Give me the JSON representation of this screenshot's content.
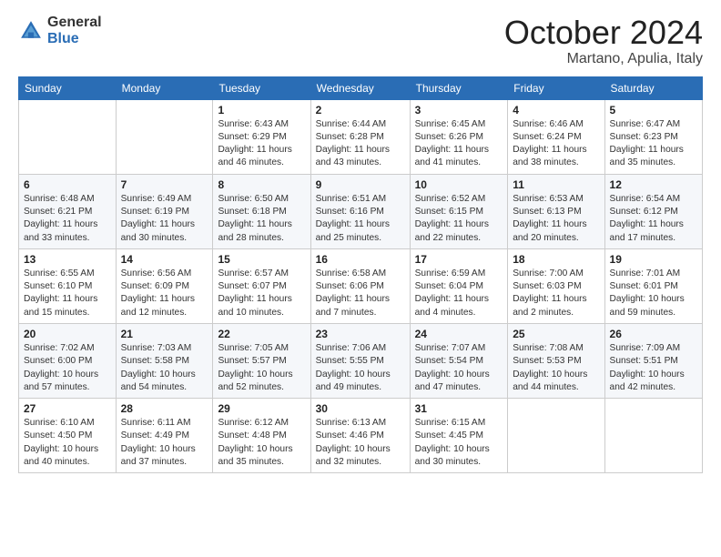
{
  "header": {
    "logo_general": "General",
    "logo_blue": "Blue",
    "title": "October 2024",
    "location": "Martano, Apulia, Italy"
  },
  "weekdays": [
    "Sunday",
    "Monday",
    "Tuesday",
    "Wednesday",
    "Thursday",
    "Friday",
    "Saturday"
  ],
  "weeks": [
    [
      {
        "day": "",
        "info": ""
      },
      {
        "day": "",
        "info": ""
      },
      {
        "day": "1",
        "info": "Sunrise: 6:43 AM\nSunset: 6:29 PM\nDaylight: 11 hours and 46 minutes."
      },
      {
        "day": "2",
        "info": "Sunrise: 6:44 AM\nSunset: 6:28 PM\nDaylight: 11 hours and 43 minutes."
      },
      {
        "day": "3",
        "info": "Sunrise: 6:45 AM\nSunset: 6:26 PM\nDaylight: 11 hours and 41 minutes."
      },
      {
        "day": "4",
        "info": "Sunrise: 6:46 AM\nSunset: 6:24 PM\nDaylight: 11 hours and 38 minutes."
      },
      {
        "day": "5",
        "info": "Sunrise: 6:47 AM\nSunset: 6:23 PM\nDaylight: 11 hours and 35 minutes."
      }
    ],
    [
      {
        "day": "6",
        "info": "Sunrise: 6:48 AM\nSunset: 6:21 PM\nDaylight: 11 hours and 33 minutes."
      },
      {
        "day": "7",
        "info": "Sunrise: 6:49 AM\nSunset: 6:19 PM\nDaylight: 11 hours and 30 minutes."
      },
      {
        "day": "8",
        "info": "Sunrise: 6:50 AM\nSunset: 6:18 PM\nDaylight: 11 hours and 28 minutes."
      },
      {
        "day": "9",
        "info": "Sunrise: 6:51 AM\nSunset: 6:16 PM\nDaylight: 11 hours and 25 minutes."
      },
      {
        "day": "10",
        "info": "Sunrise: 6:52 AM\nSunset: 6:15 PM\nDaylight: 11 hours and 22 minutes."
      },
      {
        "day": "11",
        "info": "Sunrise: 6:53 AM\nSunset: 6:13 PM\nDaylight: 11 hours and 20 minutes."
      },
      {
        "day": "12",
        "info": "Sunrise: 6:54 AM\nSunset: 6:12 PM\nDaylight: 11 hours and 17 minutes."
      }
    ],
    [
      {
        "day": "13",
        "info": "Sunrise: 6:55 AM\nSunset: 6:10 PM\nDaylight: 11 hours and 15 minutes."
      },
      {
        "day": "14",
        "info": "Sunrise: 6:56 AM\nSunset: 6:09 PM\nDaylight: 11 hours and 12 minutes."
      },
      {
        "day": "15",
        "info": "Sunrise: 6:57 AM\nSunset: 6:07 PM\nDaylight: 11 hours and 10 minutes."
      },
      {
        "day": "16",
        "info": "Sunrise: 6:58 AM\nSunset: 6:06 PM\nDaylight: 11 hours and 7 minutes."
      },
      {
        "day": "17",
        "info": "Sunrise: 6:59 AM\nSunset: 6:04 PM\nDaylight: 11 hours and 4 minutes."
      },
      {
        "day": "18",
        "info": "Sunrise: 7:00 AM\nSunset: 6:03 PM\nDaylight: 11 hours and 2 minutes."
      },
      {
        "day": "19",
        "info": "Sunrise: 7:01 AM\nSunset: 6:01 PM\nDaylight: 10 hours and 59 minutes."
      }
    ],
    [
      {
        "day": "20",
        "info": "Sunrise: 7:02 AM\nSunset: 6:00 PM\nDaylight: 10 hours and 57 minutes."
      },
      {
        "day": "21",
        "info": "Sunrise: 7:03 AM\nSunset: 5:58 PM\nDaylight: 10 hours and 54 minutes."
      },
      {
        "day": "22",
        "info": "Sunrise: 7:05 AM\nSunset: 5:57 PM\nDaylight: 10 hours and 52 minutes."
      },
      {
        "day": "23",
        "info": "Sunrise: 7:06 AM\nSunset: 5:55 PM\nDaylight: 10 hours and 49 minutes."
      },
      {
        "day": "24",
        "info": "Sunrise: 7:07 AM\nSunset: 5:54 PM\nDaylight: 10 hours and 47 minutes."
      },
      {
        "day": "25",
        "info": "Sunrise: 7:08 AM\nSunset: 5:53 PM\nDaylight: 10 hours and 44 minutes."
      },
      {
        "day": "26",
        "info": "Sunrise: 7:09 AM\nSunset: 5:51 PM\nDaylight: 10 hours and 42 minutes."
      }
    ],
    [
      {
        "day": "27",
        "info": "Sunrise: 6:10 AM\nSunset: 4:50 PM\nDaylight: 10 hours and 40 minutes."
      },
      {
        "day": "28",
        "info": "Sunrise: 6:11 AM\nSunset: 4:49 PM\nDaylight: 10 hours and 37 minutes."
      },
      {
        "day": "29",
        "info": "Sunrise: 6:12 AM\nSunset: 4:48 PM\nDaylight: 10 hours and 35 minutes."
      },
      {
        "day": "30",
        "info": "Sunrise: 6:13 AM\nSunset: 4:46 PM\nDaylight: 10 hours and 32 minutes."
      },
      {
        "day": "31",
        "info": "Sunrise: 6:15 AM\nSunset: 4:45 PM\nDaylight: 10 hours and 30 minutes."
      },
      {
        "day": "",
        "info": ""
      },
      {
        "day": "",
        "info": ""
      }
    ]
  ]
}
